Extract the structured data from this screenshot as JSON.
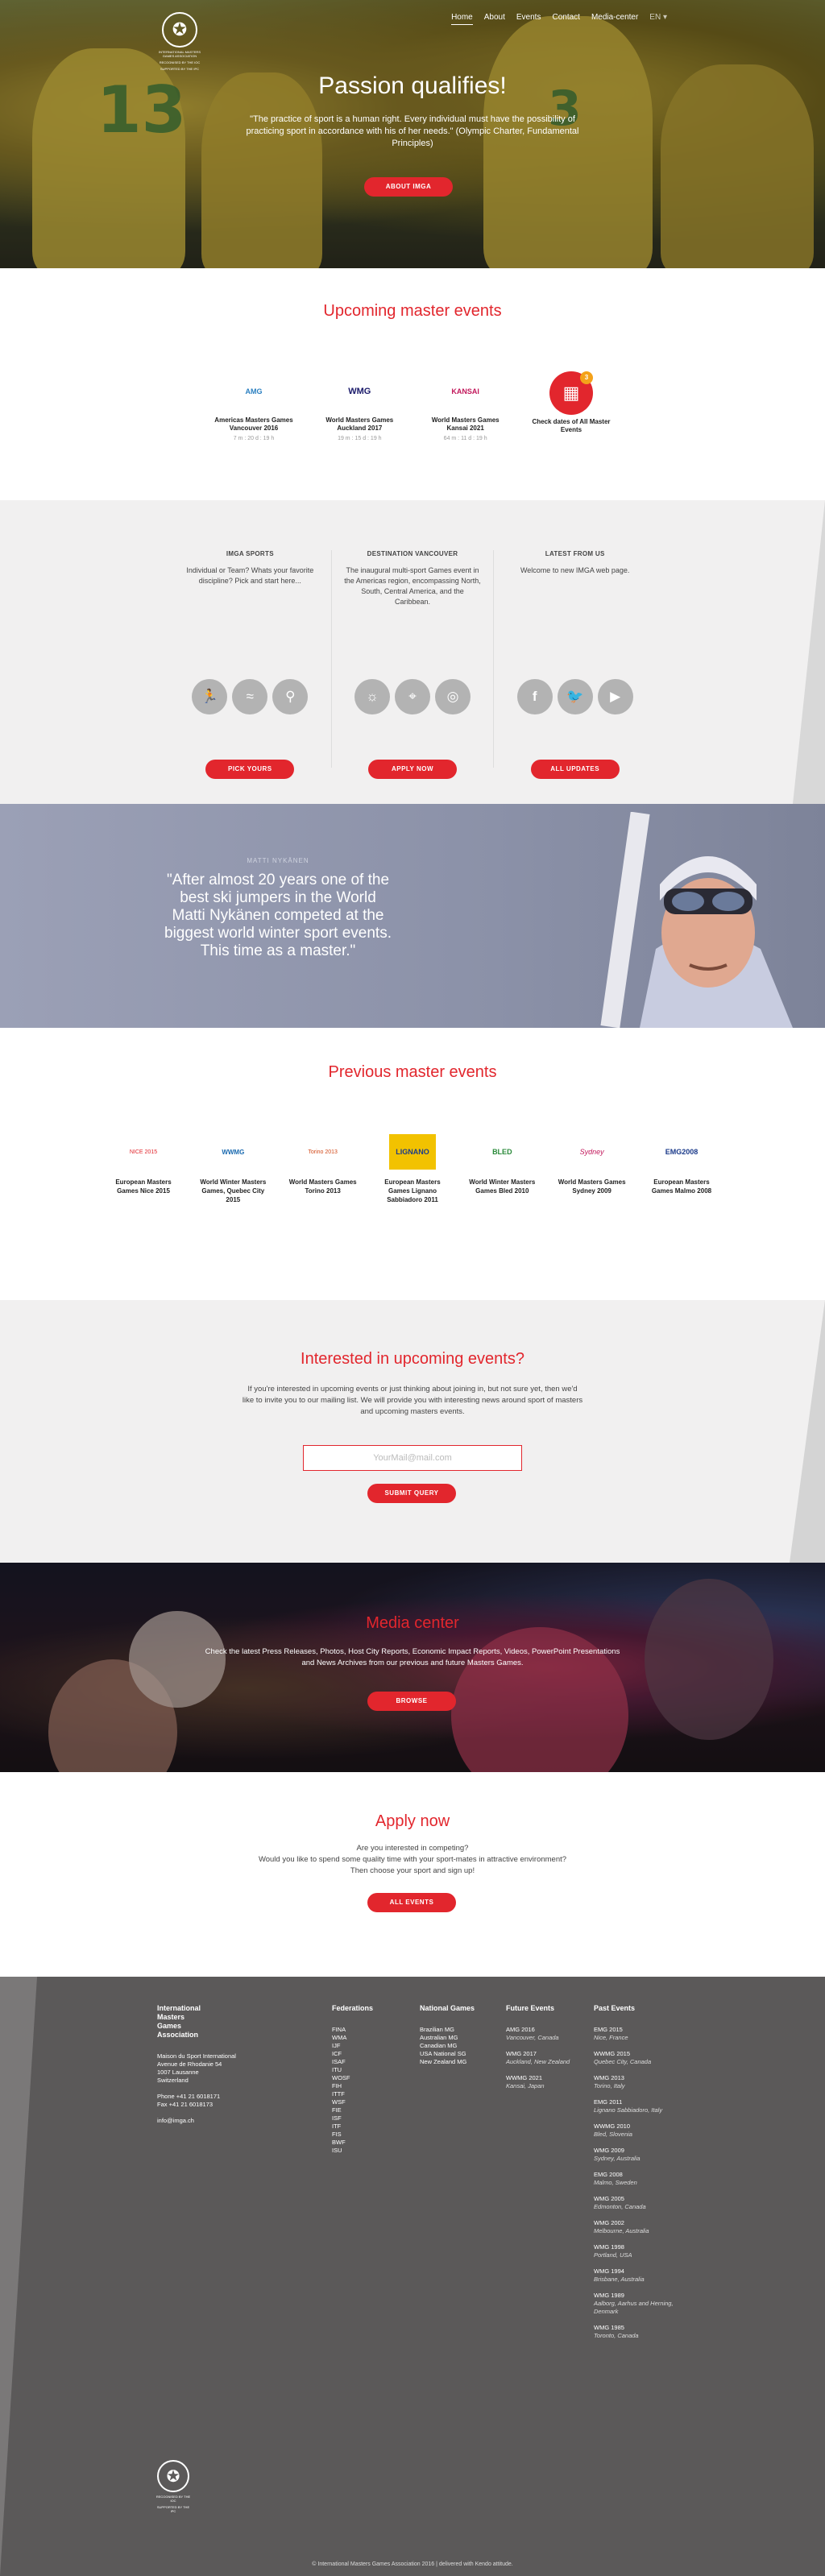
{
  "nav": {
    "items": [
      "Home",
      "About",
      "Events",
      "Contact",
      "Media-center"
    ],
    "lang": "EN ▾",
    "logo_text": "International Masters Games Association",
    "logo_sub1": "Recognised by the IOC",
    "logo_sub2": "Supported by the IPC"
  },
  "hero": {
    "title": "Passion qualifies!",
    "quote": "\"The practice of sport is a human right. Every individual must have the possibility of practicing sport in accordance with his of her needs.\" (Olympic Charter, Fundamental Principles)",
    "button": "ABOUT IMGA"
  },
  "upcoming": {
    "title": "Upcoming master events",
    "items": [
      {
        "logo": "AMG",
        "name": "Americas Masters Games Vancouver 2016",
        "meta": "7 m : 20 d : 19 h"
      },
      {
        "logo": "WMG",
        "name": "World Masters Games Auckland 2017",
        "meta": "19 m : 15 d : 19 h"
      },
      {
        "logo": "KANSAI",
        "name": "World Masters Games Kansai 2021",
        "meta": "64 m : 11 d : 19 h"
      },
      {
        "logo": "cal",
        "name": "Check dates of All Master Events",
        "meta": "",
        "badge": "3"
      }
    ]
  },
  "info": {
    "cols": [
      {
        "title": "IMGA SPORTS",
        "text": "Individual or Team? Whats your favorite discipline? Pick and start here...",
        "icons": [
          "run-icon",
          "swim-icon",
          "bike-icon"
        ],
        "button": "PICK YOURS"
      },
      {
        "title": "DESTINATION VANCOUVER",
        "text": "The inaugural multi-sport Games event in the Americas region, encompassing North, South, Central America, and the Caribbean.",
        "icons": [
          "sun-icon",
          "location-icon",
          "lifebuoy-icon"
        ],
        "button": "APPLY NOW"
      },
      {
        "title": "LATEST FROM US",
        "text": "Welcome to new IMGA web page.",
        "icons": [
          "facebook-icon",
          "twitter-icon",
          "youtube-icon"
        ],
        "button": "ALL UPDATES"
      }
    ]
  },
  "banner": {
    "name": "MATTI NYKÄNEN",
    "quote": "\"After almost 20 years one of the best ski jumpers in the World Matti Nykänen competed at the biggest world winter sport events. This time as a master.\""
  },
  "previous": {
    "title": "Previous master events",
    "items": [
      {
        "logo": "NICE 2015",
        "name": "European Masters Games Nice 2015"
      },
      {
        "logo": "WWMG",
        "name": "World Winter Masters Games, Quebec City 2015"
      },
      {
        "logo": "Torino 2013",
        "name": "World Masters Games Torino 2013"
      },
      {
        "logo": "LIGNANO",
        "name": "European Masters Games Lignano Sabbiadoro 2011"
      },
      {
        "logo": "BLED",
        "name": "World Winter Masters Games Bled 2010"
      },
      {
        "logo": "Sydney",
        "name": "World Masters Games Sydney 2009"
      },
      {
        "logo": "EMG2008",
        "name": "European Masters Games Malmo 2008"
      }
    ]
  },
  "interested": {
    "title": "Interested in upcoming events?",
    "text": "If you're interested in upcoming events or just thinking about joining in, but not sure yet, then we'd like to invite you to our mailing list. We will provide you with interesting news around sport of masters and upcoming masters events.",
    "placeholder": "YourMail@mail.com",
    "button": "SUBMIT QUERY"
  },
  "media": {
    "title": "Media center",
    "text": "Check the latest Press Releases, Photos, Host City Reports, Economic Impact Reports, Videos, PowerPoint Presentations and News Archives from our previous and future Masters Games.",
    "button": "BROWSE"
  },
  "apply": {
    "title": "Apply now",
    "lines": [
      "Are you interested in competing?",
      "Would you like to spend some quality time with your sport-mates in attractive environment?",
      "Then choose your sport and sign up!"
    ],
    "button": "ALL EVENTS"
  },
  "footer": {
    "org": [
      "International",
      "Masters",
      "Games",
      "Association"
    ],
    "address": [
      "Maison du Sport International",
      "Avenue de Rhodanie 54",
      "1007 Lausanne",
      "Switzerland"
    ],
    "phone": "Phone +41 21 6018171",
    "fax": "Fax +41 21 6018173",
    "email": "info@imga.ch",
    "federations_title": "Federations",
    "federations": [
      "FINA",
      "WMA",
      "IJF",
      "ICF",
      "ISAF",
      "ITU",
      "WOSF",
      "FIH",
      "ITTF",
      "WSF",
      "FIE",
      "ISF",
      "ITF",
      "FIS",
      "BWF",
      "ISU"
    ],
    "national_title": "National Games",
    "national": [
      "Brazilian MG",
      "Australian MG",
      "Canadian MG",
      "USA National SG",
      "New Zealand MG"
    ],
    "future_title": "Future Events",
    "future": [
      {
        "name": "AMG 2016",
        "place": "Vancouver, Canada"
      },
      {
        "name": "WMG 2017",
        "place": "Auckland, New Zealand"
      },
      {
        "name": "WWMG 2021",
        "place": "Kansai, Japan"
      }
    ],
    "past_title": "Past Events",
    "past": [
      {
        "name": "EMG 2015",
        "place": "Nice, France"
      },
      {
        "name": "WWMG 2015",
        "place": "Quebec City, Canada"
      },
      {
        "name": "WMG 2013",
        "place": "Torino, Italy"
      },
      {
        "name": "EMG 2011",
        "place": "Lignano Sabbiadoro, Italy"
      },
      {
        "name": "WWMG 2010",
        "place": "Bled, Slovenia"
      },
      {
        "name": "WMG 2009",
        "place": "Sydney, Australia"
      },
      {
        "name": "EMG 2008",
        "place": "Malmo, Sweden"
      },
      {
        "name": "WMG 2005",
        "place": "Edmonton, Canada"
      },
      {
        "name": "WMG 2002",
        "place": "Melbourne, Australia"
      },
      {
        "name": "WMG 1998",
        "place": "Portland, USA"
      },
      {
        "name": "WMG 1994",
        "place": "Brisbane, Australia"
      },
      {
        "name": "WMG 1989",
        "place": "Aalborg, Aarhus and Herning, Denmark"
      },
      {
        "name": "WMG 1985",
        "place": "Toronto, Canada"
      }
    ],
    "copyright": "© International Masters Games Association 2016 | delivered with Kendo attitude."
  },
  "colors": {
    "accent": "#e2262d",
    "footer": "#5b5959",
    "grey": "#f1f0f0"
  }
}
